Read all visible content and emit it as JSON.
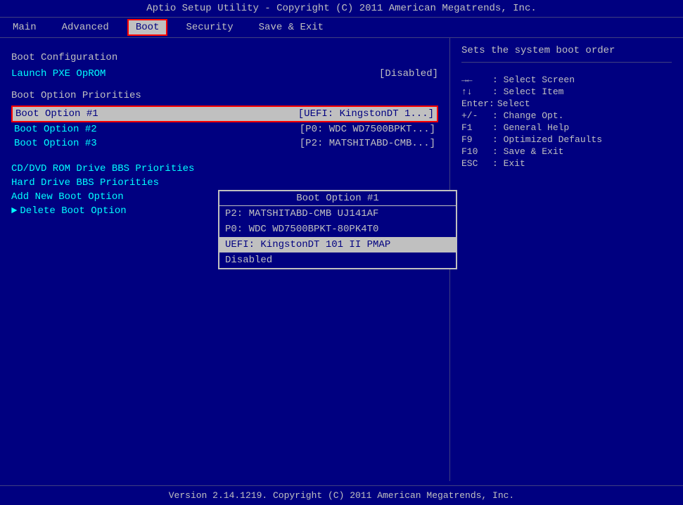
{
  "title_bar": {
    "text": "Aptio Setup Utility - Copyright (C) 2011 American Megatrends, Inc."
  },
  "menu": {
    "items": [
      {
        "id": "main",
        "label": "Main",
        "active": false
      },
      {
        "id": "advanced",
        "label": "Advanced",
        "active": false
      },
      {
        "id": "boot",
        "label": "Boot",
        "active": true
      },
      {
        "id": "security",
        "label": "Security",
        "active": false
      },
      {
        "id": "save_exit",
        "label": "Save & Exit",
        "active": false
      }
    ]
  },
  "left_panel": {
    "boot_config_title": "Boot Configuration",
    "launch_pxe_label": "Launch PXE OpROM",
    "launch_pxe_value": "[Disabled]",
    "boot_option_priorities_title": "Boot Option Priorities",
    "boot_options": [
      {
        "label": "Boot Option #1",
        "value": "[UEFI: KingstonDT 1...]",
        "selected": true
      },
      {
        "label": "Boot Option #2",
        "value": "[P0: WDC WD7500BPKT...]"
      },
      {
        "label": "Boot Option #3",
        "value": "[P2: MATSHITABD-CMB...]"
      }
    ],
    "cd_dvd_label": "CD/DVD ROM Drive BBS Priorities",
    "hard_drive_label": "Hard Drive BBS Priorities",
    "add_new_label": "Add New Boot Option",
    "delete_label": "Delete Boot Option"
  },
  "dropdown": {
    "title": "Boot Option #1",
    "items": [
      {
        "label": "P2: MATSHITABD-CMB UJ141AF",
        "highlighted": false
      },
      {
        "label": "P0: WDC WD7500BPKT-80PK4T0",
        "highlighted": false
      },
      {
        "label": "UEFI: KingstonDT 101 II PMAP",
        "highlighted": true
      },
      {
        "label": "Disabled",
        "highlighted": false,
        "disabled": true
      }
    ]
  },
  "right_panel": {
    "help_text": "Sets the system boot order",
    "divider": true,
    "keys": [
      {
        "key": "→←",
        "desc": ": Select Screen"
      },
      {
        "key": "↑↓",
        "desc": ": Select Item"
      },
      {
        "key": "Enter:",
        "desc": "Select"
      },
      {
        "key": "+/-",
        "desc": ": Change Opt."
      },
      {
        "key": "F1",
        "desc": ": General Help"
      },
      {
        "key": "F9",
        "desc": ": Optimized Defaults"
      },
      {
        "key": "F10",
        "desc": ": Save & Exit"
      },
      {
        "key": "ESC",
        "desc": ": Exit"
      }
    ]
  },
  "status_bar": {
    "text": "Version 2.14.1219. Copyright (C) 2011 American Megatrends, Inc."
  }
}
